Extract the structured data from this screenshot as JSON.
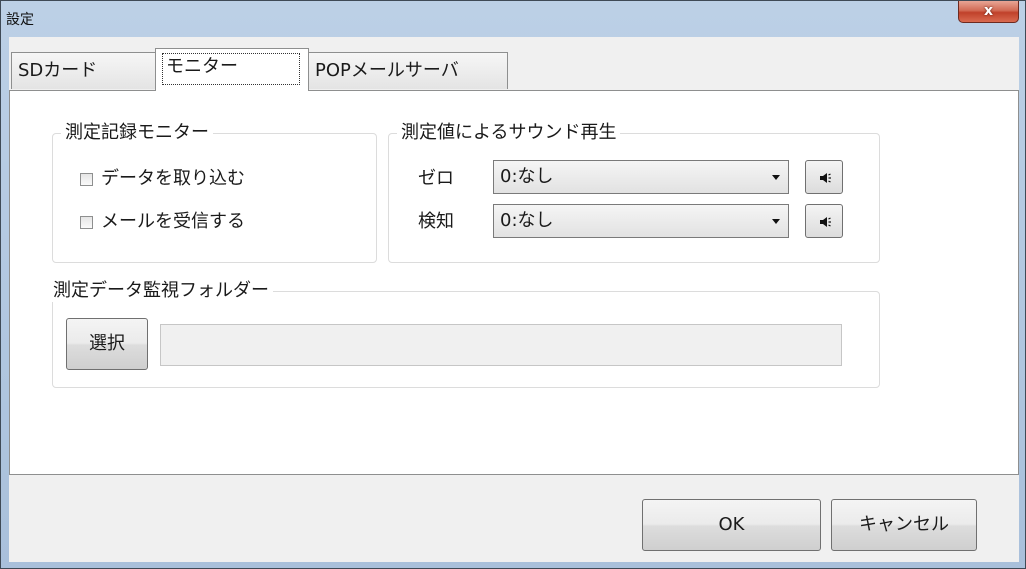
{
  "window": {
    "title": "設定",
    "close_glyph": "x"
  },
  "tabs": [
    {
      "label": "SDカード",
      "selected": false
    },
    {
      "label": "モニター",
      "selected": true
    },
    {
      "label": "POPメールサーバ",
      "selected": false
    }
  ],
  "monitor_group": {
    "legend": "測定記録モニター",
    "checkboxes": [
      {
        "label": "データを取り込む",
        "checked": false
      },
      {
        "label": "メールを受信する",
        "checked": false
      }
    ]
  },
  "sound_group": {
    "legend": "測定値によるサウンド再生",
    "rows": [
      {
        "label": "ゼロ",
        "value": "0:なし",
        "icon": "speaker-icon"
      },
      {
        "label": "検知",
        "value": "0:なし",
        "icon": "speaker-icon"
      }
    ]
  },
  "folder_group": {
    "legend": "測定データ監視フォルダー",
    "select_label": "選択",
    "path_value": ""
  },
  "footer": {
    "ok_label": "OK",
    "cancel_label": "キャンセル"
  }
}
